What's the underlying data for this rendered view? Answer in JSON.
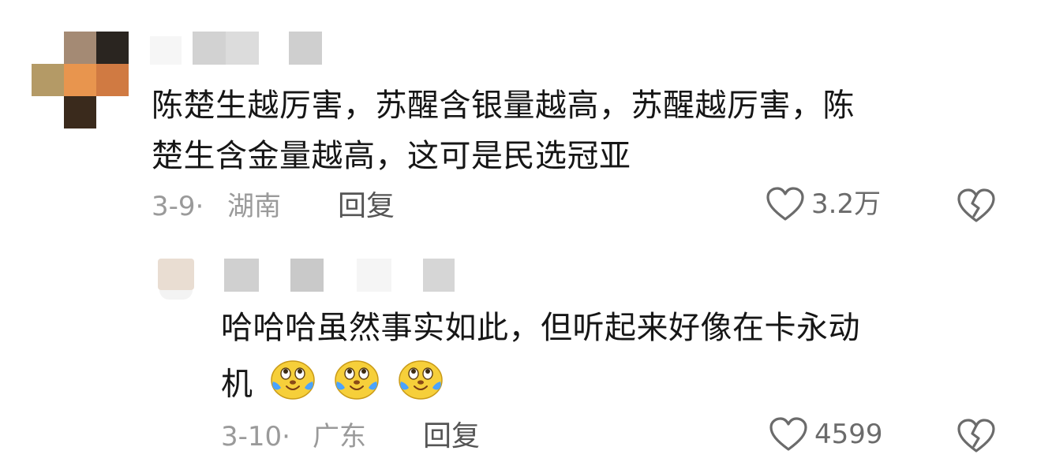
{
  "comment": {
    "lines": [
      "陈楚生越厉害，苏醒含银量越高，苏醒越厉害，陈",
      "楚生含金量越高，这可是民选冠亚"
    ],
    "date": "3-9",
    "separator": "·",
    "location": "湖南",
    "reply_label": "回复",
    "likes": "3.2万"
  },
  "reply": {
    "lines": [
      "哈哈哈虽然事实如此，但听起来好像在卡永动",
      "机"
    ],
    "emoji_count": 3,
    "emoji_name": "crying-laughing-emoji",
    "date": "3-10",
    "separator": "·",
    "location": "广东",
    "reply_label": "回复",
    "likes": "4599"
  },
  "icons": {
    "like": "heart-outline-icon",
    "dislike": "broken-heart-icon"
  },
  "colors": {
    "text": "#161616",
    "meta": "#9a9a9a",
    "icon": "#6b6b6b"
  }
}
